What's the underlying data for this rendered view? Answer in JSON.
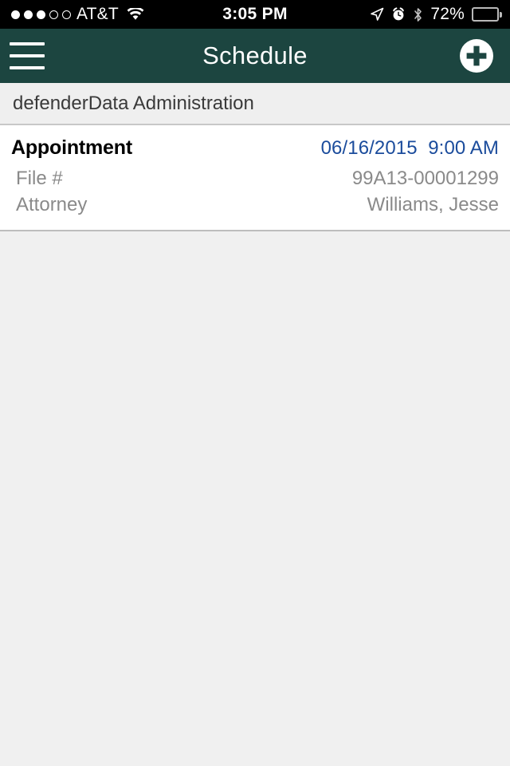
{
  "statusbar": {
    "signal_dots_filled": 3,
    "signal_dots_total": 5,
    "carrier": "AT&T",
    "wifi_icon": "wifi-icon",
    "time": "3:05 PM",
    "location_icon": "location-arrow-icon",
    "alarm_icon": "alarm-clock-icon",
    "bluetooth_icon": "bluetooth-icon",
    "battery_percent": "72%",
    "battery_level": 72,
    "battery_icon": "battery-icon"
  },
  "navbar": {
    "menu_icon": "hamburger-menu-icon",
    "title": "Schedule",
    "add_icon": "plus-circle-icon",
    "background": "#1c4540"
  },
  "section": {
    "header": "defenderData Administration"
  },
  "appointment": {
    "title": "Appointment",
    "datetime": "06/16/2015  9:00 AM",
    "datetime_color": "#1b4c9c",
    "details": [
      {
        "label": "File #",
        "value": "99A13-00001299"
      },
      {
        "label": "Attorney",
        "value": "Williams, Jesse"
      }
    ]
  }
}
